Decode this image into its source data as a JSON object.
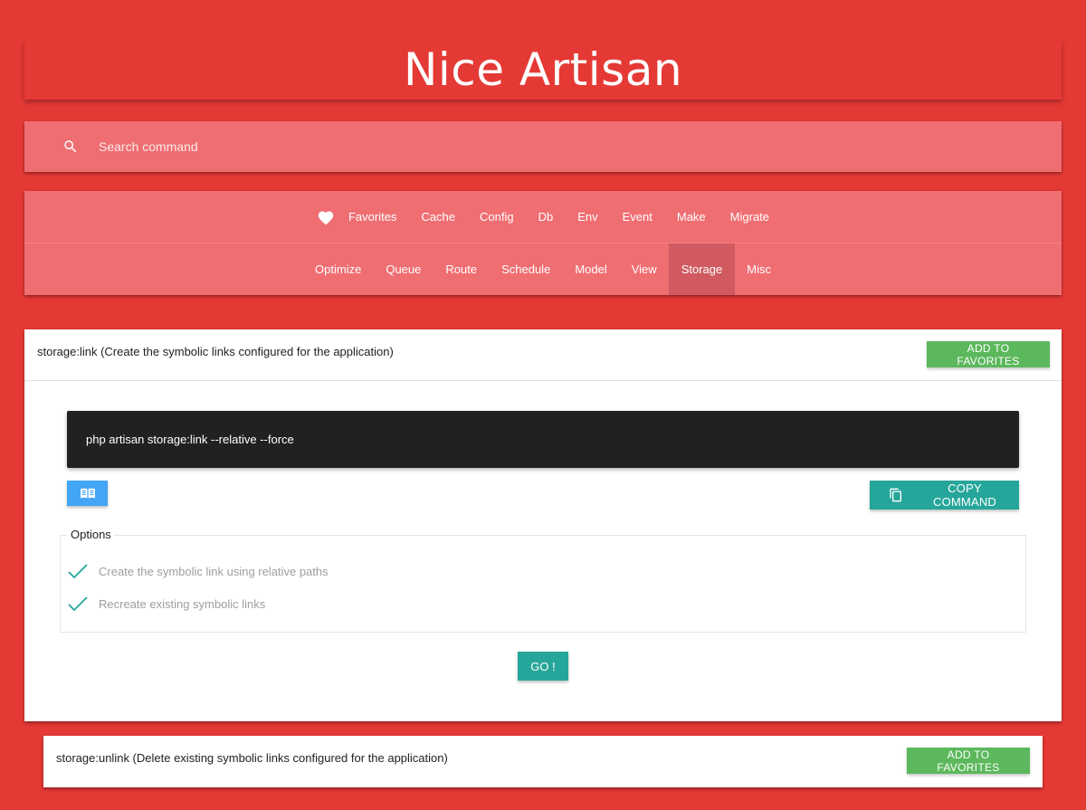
{
  "app": {
    "title": "Nice Artisan"
  },
  "search": {
    "placeholder": "Search command",
    "icon": "search-icon"
  },
  "nav": {
    "row1": [
      {
        "label": "Favorites",
        "icon": "heart-icon"
      },
      {
        "label": "Cache"
      },
      {
        "label": "Config"
      },
      {
        "label": "Db"
      },
      {
        "label": "Env"
      },
      {
        "label": "Event"
      },
      {
        "label": "Make"
      },
      {
        "label": "Migrate"
      }
    ],
    "row2": [
      {
        "label": "Optimize"
      },
      {
        "label": "Queue"
      },
      {
        "label": "Route"
      },
      {
        "label": "Schedule"
      },
      {
        "label": "Model"
      },
      {
        "label": "View"
      },
      {
        "label": "Storage",
        "active": true
      },
      {
        "label": "Misc"
      }
    ]
  },
  "commands": [
    {
      "title": "storage:link (Create the symbolic links configured for the application)",
      "favorite_label": "ADD TO FAVORITES",
      "command_line": "php artisan storage:link --relative --force",
      "copy_label": "COPY COMMAND",
      "options_legend": "Options",
      "options": [
        {
          "label": "Create the symbolic link using relative paths",
          "checked": true
        },
        {
          "label": "Recreate existing symbolic links",
          "checked": true
        }
      ],
      "go_label": "GO !"
    },
    {
      "title": "storage:unlink (Delete existing symbolic links configured for the application)",
      "favorite_label": "ADD TO FAVORITES"
    }
  ],
  "colors": {
    "background": "#e53935",
    "nav_bg": "#ef6e72",
    "active_tab": "#d05a5f",
    "favorite_button": "#5cb85c",
    "teal_button": "#26a69a",
    "doc_button": "#42a5f5",
    "terminal": "#212121"
  }
}
